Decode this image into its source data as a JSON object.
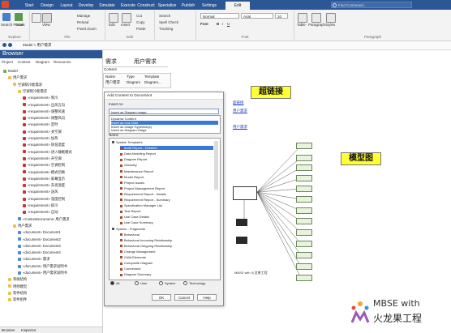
{
  "titlebar": {
    "tabs": [
      "Start",
      "Design",
      "Layout",
      "Develop",
      "Simulate",
      "Execute",
      "Construct",
      "Specialize",
      "Publish",
      "Settings",
      "Edit"
    ],
    "active_tab": "Edit",
    "find_placeholder": "Find Command..."
  },
  "ribbon": {
    "explore": {
      "label": "Explore",
      "buttons": [
        "Search Portals",
        "Save",
        "View"
      ]
    },
    "file": {
      "label": "File",
      "buttons": [
        "Manage",
        "Reload",
        "Fixed Zoom"
      ]
    },
    "edit": {
      "label": "Edit",
      "buttons": [
        "Edit",
        "Insert",
        "Cut",
        "Copy",
        "Paste"
      ]
    },
    "tools": {
      "buttons": [
        "Search",
        "Spell Check",
        "Tracking"
      ]
    },
    "font": {
      "label": "Font",
      "style": "Normal",
      "face": "Arial",
      "size": "10",
      "buttons": [
        "Font"
      ]
    },
    "paragraph": {
      "label": "Paragraph",
      "buttons": [
        "Table",
        "Paragraph",
        "Styles"
      ]
    }
  },
  "navbar": {
    "path": "Model  >  用户需求"
  },
  "browser": {
    "title": "Browser",
    "tabs": [
      "Project",
      "Context",
      "Diagram",
      "Resources"
    ],
    "tree": [
      "Model",
      "用户需求",
      "空调制冷能需求",
      "空调制冷能需求",
      "«requirement» 制冷",
      "«requirement» 出风方向",
      "«requirement» 调整风速",
      "«requirement» 调整风向",
      "«requirement» 定时",
      "«requirement» 关空调",
      "«requirement» 加热",
      "«requirement» 除低温度",
      "«requirement» 进入睡眠模式",
      "«requirement» 开空调",
      "«requirement» 空调控制",
      "«requirement» 模式切换",
      "«requirement» 屏幕显示",
      "«requirement» 升高温度",
      "«requirement» 送风",
      "«requirement» 温度控制",
      "«requirement» 抑冷",
      "«requirement» 自动",
      "«CustomDocument» 用户需求",
      "用户需求",
      "«document» Document1",
      "«document» Document2",
      "«document» Document3",
      "«document» Document4",
      "«document» 需求",
      "«document» 用户需求说明书",
      "«document» 用户需求说明书",
      "系统结构",
      "用例模型",
      "软件结构",
      "软件组件"
    ],
    "bottom_tabs": [
      "Browser",
      "Inspector"
    ]
  },
  "document": {
    "tabs": [
      "需求",
      "用户需求"
    ],
    "outline_label": "Content",
    "table_headers": [
      "Name",
      "Type",
      "Template"
    ],
    "table_row": [
      "用户需求",
      "Diagram",
      "Diagram..."
    ],
    "links": [
      "超链接",
      "用户需求",
      "用户需求"
    ],
    "callout_link": "超链接",
    "callout_model": "模型图",
    "diagram_caption": "MBSE with 火龙果工程"
  },
  "dialog": {
    "title": "Add Content to Document",
    "insert_as_label": "Insert As",
    "insert_options": [
      "Insert as Diagram image",
      "Dynamic Content",
      "Insert as Link Note",
      "Insert as Image Hyperlink(s)",
      "Insert as Diagram image"
    ],
    "selected_insert_index": 2,
    "name_label": "Name",
    "templates": [
      "System Templates",
      "Audit Report - Detailed",
      "Data Modeling Report",
      "Diagram Report",
      "Glossary",
      "Maintenance Report",
      "Model Report",
      "Project Issues",
      "Project Management Report",
      "Requirement Report - Details",
      "Requirement Report - Summary",
      "Specification Manager List",
      "Test Report",
      "Use Case Details",
      "Use Case Summary",
      "System - Fragments",
      "Behavioral",
      "Behavioral Incoming Relationship",
      "Behavioral Outgoing Relationship",
      "Change Management",
      "Child Elements",
      "Composite Diagram",
      "Connectors",
      "Diagram Summary"
    ],
    "selected_template_index": 1,
    "filters": [
      "All",
      "User",
      "System",
      "Technology"
    ],
    "buttons": [
      "OK",
      "Cancel",
      "Help"
    ]
  },
  "watermark": {
    "line1": "MBSE with",
    "line2": "火龙果工程"
  },
  "colors": {
    "titlebar": "#2b5797",
    "callout": "#ffff33",
    "selection": "#3a78d8",
    "link": "#1a3ccc"
  }
}
